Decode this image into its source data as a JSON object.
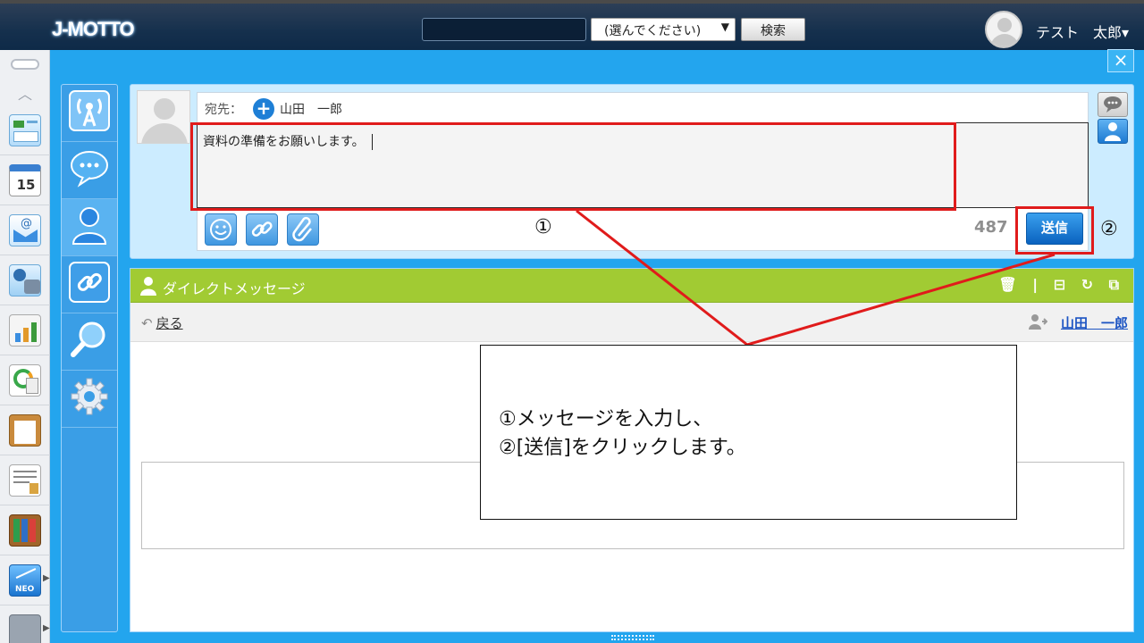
{
  "header": {
    "logo_text": "J-MOTTO",
    "search_value": "",
    "select_value": "(選んでください)",
    "search_button": "検索",
    "user_name": "テスト　太郎▾"
  },
  "sidebar": {
    "calendar_day": "15",
    "items": [
      "pill-toggle",
      "chevron-up",
      "portal",
      "calendar",
      "mail",
      "contacts",
      "reports",
      "workflow",
      "clipboard",
      "bulletin",
      "files",
      "neo",
      "folder"
    ]
  },
  "nav": [
    "broadcast",
    "chat",
    "profile",
    "link",
    "search",
    "settings"
  ],
  "compose": {
    "to_label": "宛先：",
    "recipient": "山田　一郎",
    "message": "資料の準備をお願いします。",
    "char_count": "487",
    "send_label": "送信",
    "marker1": "①",
    "marker2": "②"
  },
  "dm_panel": {
    "title": "ダイレクトメッセージ",
    "back_label": "戻る",
    "peer_name": "山田　一郎",
    "tools": "🗑 | ⊟ ↻ ⧉"
  },
  "callout": {
    "line1": "①メッセージを入力し、",
    "line2": "②[送信]をクリックします。"
  },
  "colors": {
    "accent_red": "#e01b1b",
    "dm_green": "#a1cb33",
    "main_blue": "#23a5ee"
  }
}
